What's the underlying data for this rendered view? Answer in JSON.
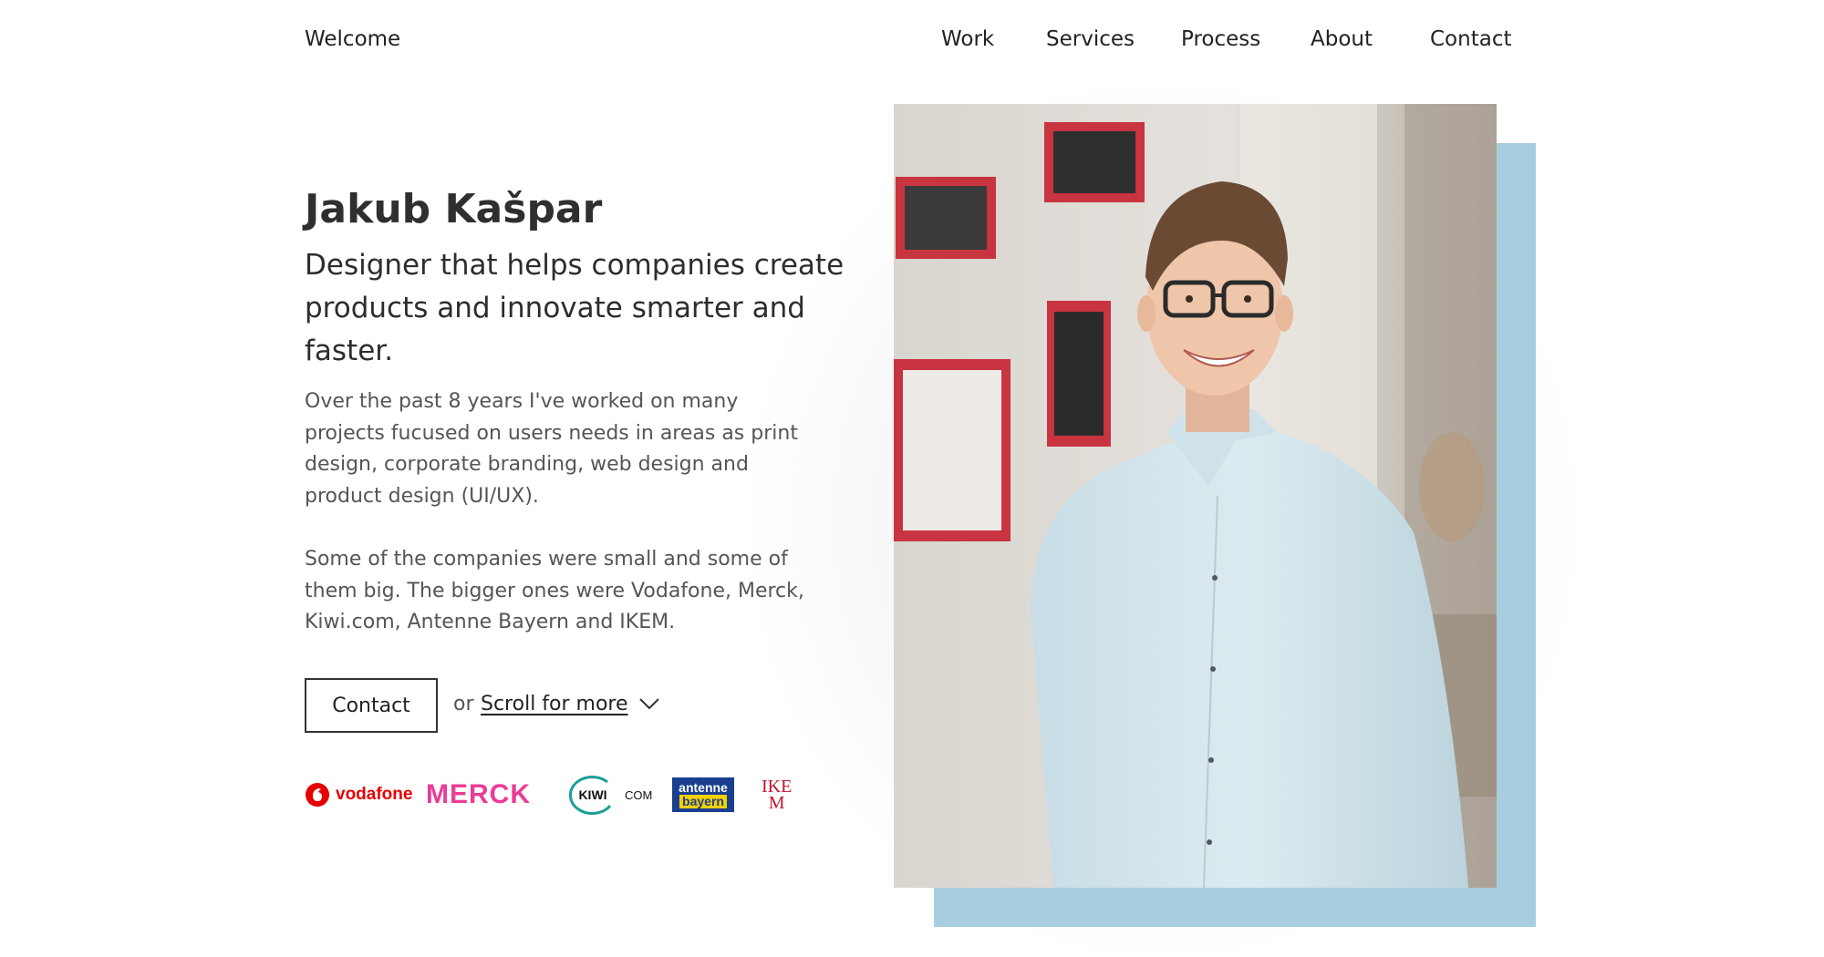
{
  "header": {
    "site_name": "Welcome",
    "nav": [
      {
        "label": "Work"
      },
      {
        "label": "Services"
      },
      {
        "label": "Process"
      },
      {
        "label": "About"
      },
      {
        "label": "Contact"
      }
    ]
  },
  "hero": {
    "name": "Jakub Kašpar",
    "tagline": "Designer that helps companies create products and innovate smarter and faster.",
    "paragraph_1": "Over the past 8 years I've worked on many projects fucused on users needs in areas as print design, corporate branding, web design and product design (UI/UX).",
    "paragraph_2": "Some of the companies were small and some of them big. The bigger ones were Vodafone, Merck, Kiwi.com, Antenne Bayern and IKEM.",
    "contact_button": "Contact",
    "or_text": "or",
    "scroll_link": "Scroll for more"
  },
  "client_logos": {
    "vodafone": "vodafone",
    "merck": "MERCK",
    "kiwi": "KIWI",
    "kiwi_com": "COM",
    "antenne_1": "antenne",
    "antenne_2": "bayern",
    "ikem_1": "IKE",
    "ikem_2": "M"
  },
  "colors": {
    "photo_backdrop": "#a8cde0",
    "shirt": "#d8e8ee",
    "vodafone": "#e60000",
    "merck": "#eb3c96",
    "kiwi": "#1a9e9a",
    "antenne_blue": "#1a3f8f",
    "antenne_yellow": "#f5d000",
    "ikem": "#c8102e"
  }
}
